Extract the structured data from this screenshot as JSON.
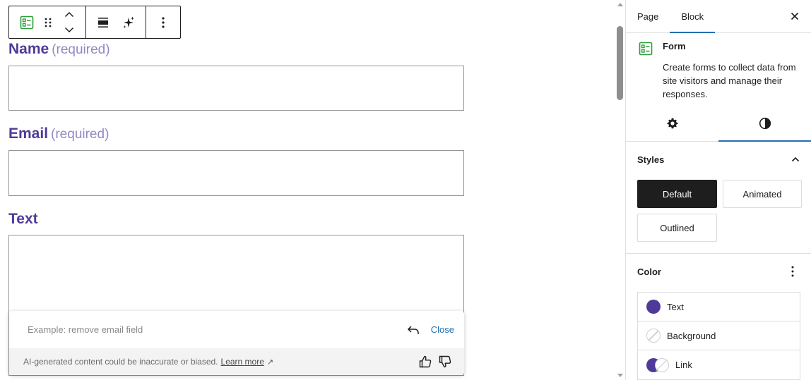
{
  "colors": {
    "accent": "#4f3a99",
    "label_muted": "#9487c4",
    "link": "#2271b1",
    "toolbar_icon_green": "#2e9d3a"
  },
  "toolbar": {
    "icons": [
      "form-block-icon",
      "drag-handle-icon",
      "move-up-icon",
      "move-down-icon",
      "align-icon",
      "ai-sparkle-icon",
      "more-options-icon"
    ]
  },
  "form": {
    "fields": [
      {
        "label": "Name",
        "required": "(required)"
      },
      {
        "label": "Email",
        "required": "(required)"
      },
      {
        "label": "Text"
      }
    ]
  },
  "ai_prompt": {
    "placeholder": "Example: remove email field",
    "close_label": "Close",
    "disclaimer": "AI-generated content could be inaccurate or biased.",
    "learn_more": "Learn more",
    "learn_more_icon": "↗"
  },
  "sidebar": {
    "tabs": [
      {
        "label": "Page"
      },
      {
        "label": "Block"
      }
    ],
    "active_tab": "Block",
    "block": {
      "title": "Form",
      "description": "Create forms to collect data from site visitors and manage their responses."
    },
    "sub_tabs": [
      "settings-gear-icon",
      "styles-half-circle-icon"
    ],
    "styles": {
      "title": "Styles",
      "options": [
        {
          "label": "Default",
          "active": true
        },
        {
          "label": "Animated"
        },
        {
          "label": "Outlined"
        }
      ]
    },
    "color": {
      "title": "Color",
      "items": [
        {
          "label": "Text"
        },
        {
          "label": "Background"
        },
        {
          "label": "Link"
        }
      ]
    }
  }
}
